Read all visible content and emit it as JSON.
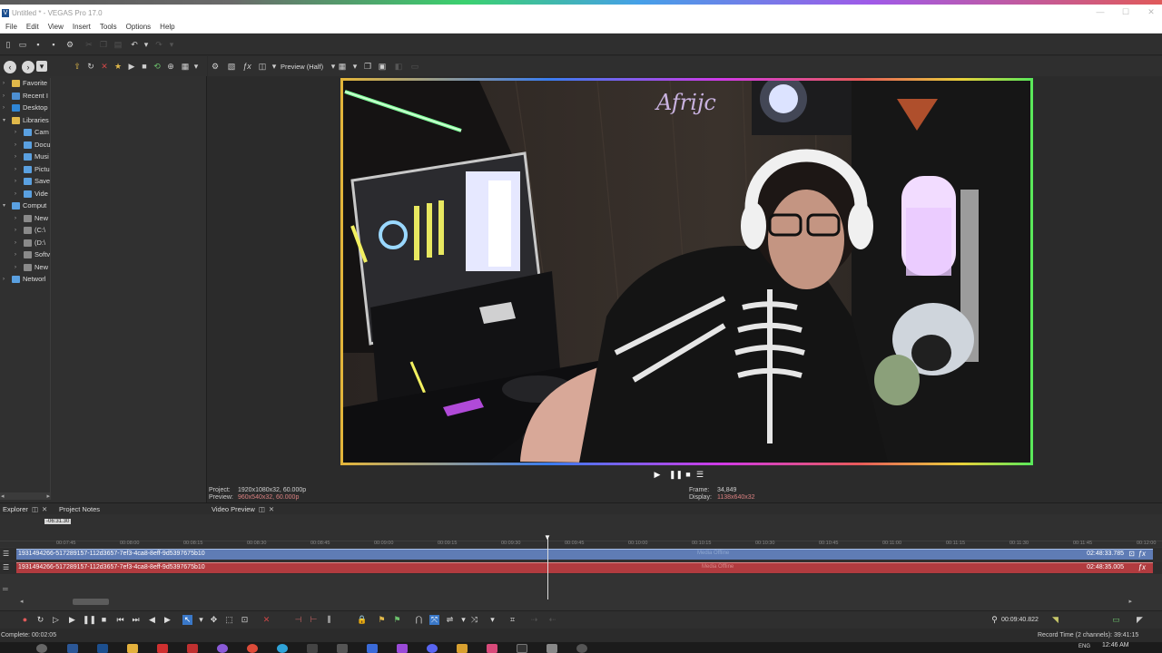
{
  "window": {
    "title": "Untitled * - VEGAS Pro 17.0",
    "app_icon": "V",
    "buttons": [
      "—",
      "☐",
      "✕"
    ]
  },
  "menu": [
    "File",
    "Edit",
    "View",
    "Insert",
    "Tools",
    "Options",
    "Help"
  ],
  "explorer": {
    "items": [
      {
        "label": "Favorite",
        "icon": "star-icon",
        "depth": 0
      },
      {
        "label": "Recent I",
        "icon": "recent-icon",
        "depth": 0
      },
      {
        "label": "Desktop",
        "icon": "desktop-icon",
        "depth": 0
      },
      {
        "label": "Libraries",
        "icon": "libraries-icon",
        "depth": 0
      },
      {
        "label": "Cam",
        "icon": "folder-icon",
        "depth": 1
      },
      {
        "label": "Docu",
        "icon": "folder-icon",
        "depth": 1
      },
      {
        "label": "Musi",
        "icon": "folder-icon",
        "depth": 1
      },
      {
        "label": "Pictu",
        "icon": "folder-icon",
        "depth": 1
      },
      {
        "label": "Save",
        "icon": "folder-icon",
        "depth": 1
      },
      {
        "label": "Vide",
        "icon": "folder-icon",
        "depth": 1
      },
      {
        "label": "Comput",
        "icon": "computer-icon",
        "depth": 0
      },
      {
        "label": "New",
        "icon": "drive-icon",
        "depth": 1
      },
      {
        "label": "(C:\\",
        "icon": "drive-icon",
        "depth": 1
      },
      {
        "label": "(D:\\",
        "icon": "drive-icon",
        "depth": 1
      },
      {
        "label": "Softv",
        "icon": "drive-icon",
        "depth": 1
      },
      {
        "label": "New",
        "icon": "drive-icon",
        "depth": 1
      },
      {
        "label": "Networl",
        "icon": "network-icon",
        "depth": 0
      }
    ]
  },
  "preview": {
    "quality": "Preview (Half)",
    "project_label": "Project:",
    "project_value": "1920x1080x32, 60.000p",
    "preview_label": "Preview:",
    "preview_value": "960x540x32, 60.000p",
    "frame_label": "Frame:",
    "frame_value": "34,849",
    "display_label": "Display:",
    "display_value": "1138x640x32"
  },
  "tabs": {
    "explorer": "Explorer",
    "project_notes": "Project Notes",
    "video_preview": "Video Preview"
  },
  "timeline": {
    "selection": "-06:31.30",
    "ticks": [
      "00:07:45",
      "00:08:00",
      "00:08:15",
      "00:08:30",
      "00:08:45",
      "00:09:00",
      "00:09:15",
      "00:09:30",
      "00:09:45",
      "00:10:00",
      "00:10:15",
      "00:10:30",
      "00:10:45",
      "00:11:00",
      "00:11:15",
      "00:11:30",
      "00:11:45",
      "00:12:00"
    ],
    "video_clip": {
      "name": "1931494266-517289157-112d3657-7ef3-4ca8-8eff-9d5397675b10",
      "end": "02:48:33.785",
      "overlay": "Media Offline"
    },
    "audio_clip": {
      "name": "1931494266-517289157-112d3657-7ef3-4ca8-8eff-9d5397675b10",
      "end": "02:48:35.005",
      "overlay": "Media Offline"
    }
  },
  "cursor_time": "00:09:40.822",
  "status": {
    "left": "Complete: 00:02:05",
    "right": "Record Time (2 channels): 39:41:15"
  },
  "taskbar": {
    "time": "12:46 AM",
    "lang": "ENG"
  },
  "video_overlay_text": "Afrijc"
}
